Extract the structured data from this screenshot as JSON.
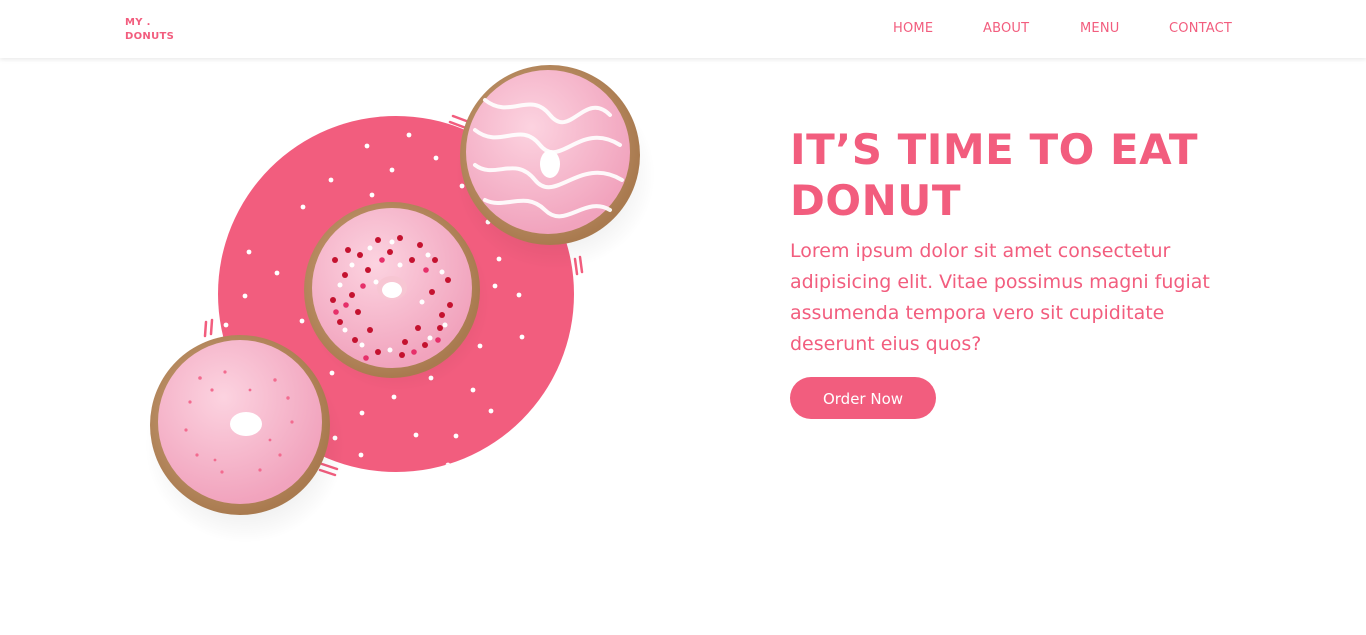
{
  "brand": {
    "logo_line1": "MY .",
    "logo_line2": "DONUTS"
  },
  "nav": {
    "items": [
      {
        "label": "HOME"
      },
      {
        "label": "ABOUT"
      },
      {
        "label": "MENU"
      },
      {
        "label": "CONTACT"
      }
    ]
  },
  "hero": {
    "title": "IT’S TIME TO EAT DONUT",
    "description": "Lorem ipsum dolor sit amet consectetur adipisicing elit. Vitae possimus magni fugiat assumenda tempora vero sit cupiditate deserunt eius quos?",
    "cta_label": "Order Now"
  },
  "colors": {
    "accent": "#f25d7e",
    "white": "#ffffff",
    "donut_icing": "#f7b8cc",
    "donut_dough": "#c9a27a"
  },
  "icons": {
    "hero_illustration": "donuts-illustration"
  }
}
